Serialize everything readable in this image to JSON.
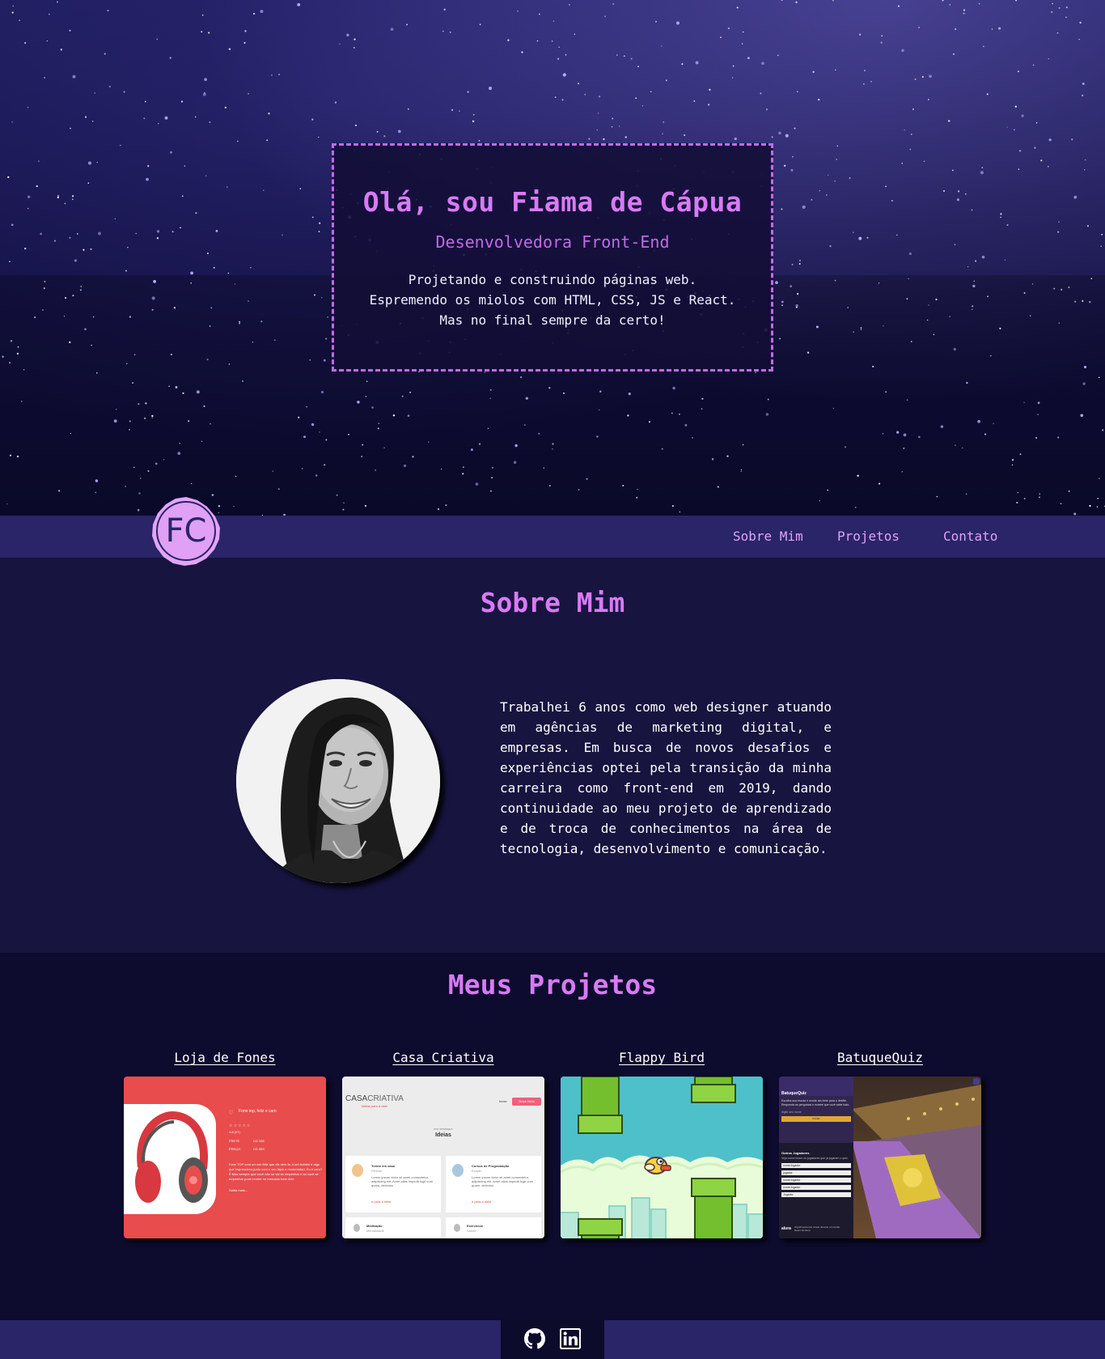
{
  "hero": {
    "title": "Olá, sou Fiama de Cápua",
    "subtitle": "Desenvolvedora Front-End",
    "lines": [
      "Projetando e construindo páginas web.",
      "Espremendo os miolos com HTML, CSS, JS e React.",
      "Mas no final sempre da certo!"
    ]
  },
  "nav": {
    "logo_text": "FC",
    "links": [
      "Sobre Mim",
      "Projetos",
      "Contato"
    ]
  },
  "about": {
    "title": "Sobre Mim",
    "text": "Trabalhei 6 anos como web designer atuando em agências de marketing digital, e empresas. Em busca de novos desafios e experiências optei pela transição da minha carreira como front-end em 2019, dando continuidade ao meu projeto de aprendizado e de troca de conhecimentos na área de tecnologia, desenvolvimento e comunicação."
  },
  "projects": {
    "title": "Meus Projetos",
    "items": [
      {
        "name": "Loja de Fones"
      },
      {
        "name": "Casa Criativa"
      },
      {
        "name": "Flappy Bird"
      },
      {
        "name": "BatuqueQuiz"
      }
    ],
    "thumb_loja": {
      "heading": "Fone top, feliz e caro",
      "rating": "4.8 (97)",
      "row1_label": "FRETE",
      "row1_value": "CD 108",
      "row2_label": "PREÇO",
      "row2_value": "CD 369",
      "body": "Fone TOP com um ser feliz que diz nem fa. A ser bobbin é algo que impressiona junto com o seu lápis e modernidad. Eu é caro? Ê Mas sempre que você não se vai se empenhar e ao você se empenhar pode render no mercado fone dele.",
      "more": "Saiba mais..."
    },
    "thumb_casa": {
      "brand_a": "CASA",
      "brand_b": "CRIATIVA",
      "tagline": "Ideias para a vida",
      "nav_label": "Início",
      "button": "Nova Ideia",
      "kicker": "em destaque",
      "section": "Ideias",
      "cards": [
        {
          "title": "Treino em casa",
          "tag": "Fitness",
          "body": "Lorem ipsum dolor sit amet consectetur, adipiscing elit. Amet alias impedit fugit cum quam, delectus",
          "link": "ir para a ideia"
        },
        {
          "title": "Cursos de Programação",
          "tag": "Estudo",
          "body": "Lorem ipsum dolor sit amet consectetur, adipiscing elit. Amet alias impedit fugit cum quam, delectus",
          "link": "ir para a ideia"
        },
        {
          "title": "Meditação",
          "tag": "Mentalidade",
          "body": "",
          "link": ""
        },
        {
          "title": "Exercícios",
          "tag": "Saúde",
          "body": "",
          "link": ""
        }
      ]
    },
    "thumb_batuque": {
      "title": "BatuqueQuiz",
      "body": "Escolha sua escola e monte seu time para o desfile. Responda as perguntas e mostre que você sabe tudo.",
      "field_hint": "digite seu nome",
      "button": "Iniciar",
      "q_title": "Outros Jogadores",
      "q_text": "Veja como foram os jogadores que já jogaram o quiz.",
      "players": [
        "nomeJogador",
        "jogador",
        "nomeJogador",
        "nomeJogador",
        "Jogador"
      ],
      "alura": "alura",
      "footer_text": "Orgulhosamente criado durante a Imersão React da Alura"
    },
    "footer": {
      "icons": [
        "github-icon",
        "linkedin-icon"
      ]
    }
  },
  "colors": {
    "accent": "#d97af5",
    "accent_dark": "#c26ae6",
    "nav_bg": "#2a2468",
    "page_bg": "#0c0b2c",
    "about_bg": "#17143f"
  }
}
